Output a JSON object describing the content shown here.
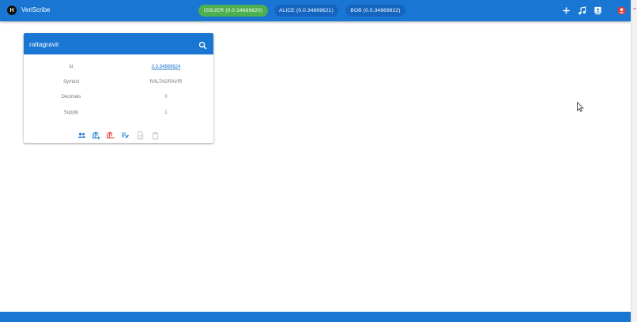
{
  "app": {
    "logo_letter": "H",
    "title": "VeriScribe"
  },
  "accounts": [
    {
      "label": "ISSUER (0.0.34869620)",
      "active": true
    },
    {
      "label": "ALICE (0.0.34869621)",
      "active": false
    },
    {
      "label": "BOB (0.0.34869622)",
      "active": false
    }
  ],
  "toolbar_icons": [
    "plus-icon",
    "music-note-icon",
    "contact-card-icon",
    "user-circle-icon"
  ],
  "token_card": {
    "title": "raltagravir",
    "fields": [
      {
        "label": "Id",
        "value": "0.0.34869624",
        "link": true
      },
      {
        "label": "Symbol",
        "value": "RALTAGRAVIR",
        "link": false
      },
      {
        "label": "Decimals",
        "value": "0",
        "link": false
      },
      {
        "label": "Supply",
        "value": "1",
        "link": false
      }
    ],
    "actions": [
      "users-icon",
      "bank-add-icon",
      "bank-remove-icon",
      "list-edit-icon",
      "document-icon",
      "trash-icon"
    ]
  },
  "colors": {
    "primary": "#1976d2",
    "issuer": "#4caf50",
    "account": "#1565c0",
    "danger": "#e53935"
  }
}
